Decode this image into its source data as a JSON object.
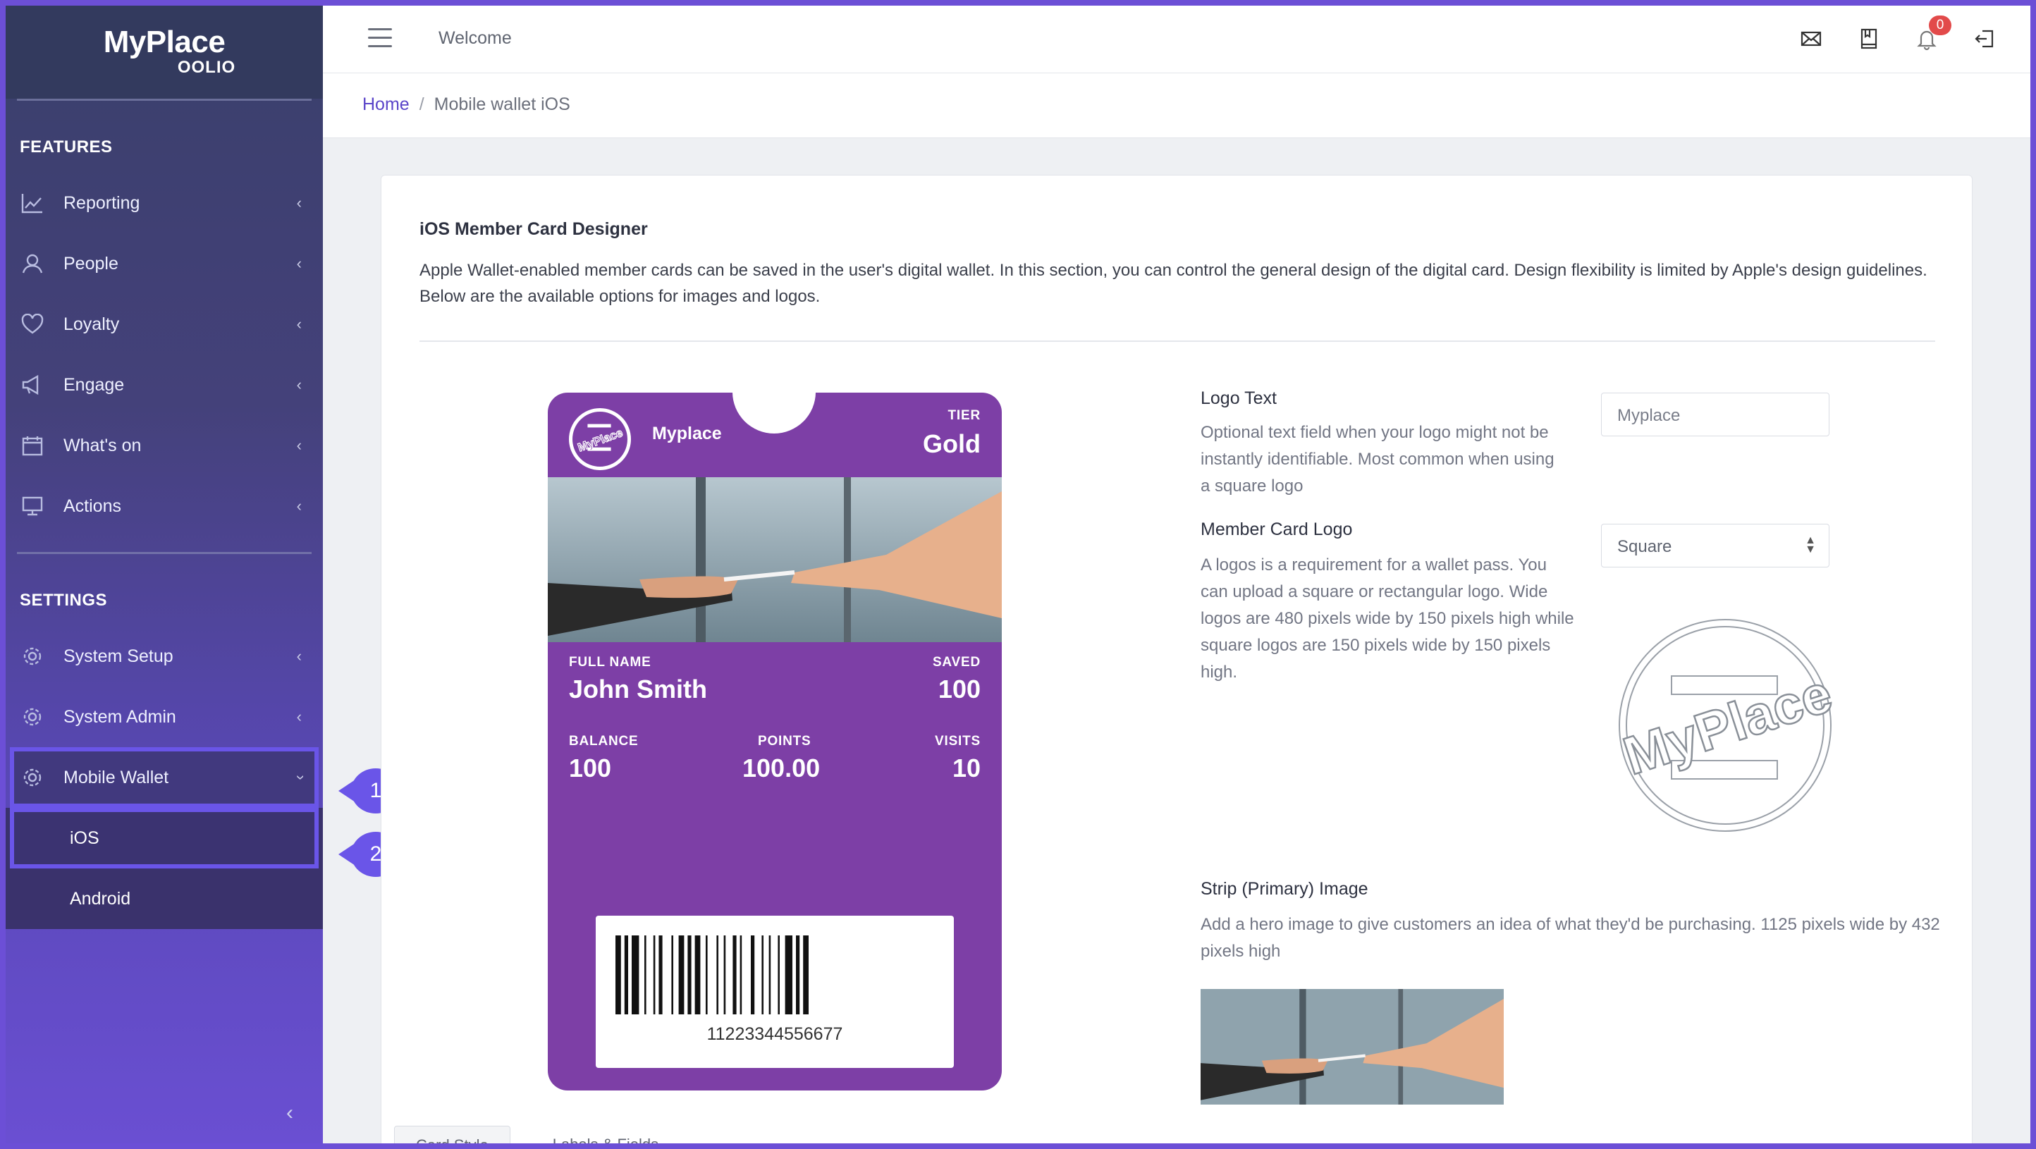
{
  "app": {
    "brand_name": "MyPlace",
    "brand_sub": "OOLIO"
  },
  "sidebar": {
    "features_title": "FEATURES",
    "features": [
      {
        "label": "Reporting",
        "icon": "chart-line-icon"
      },
      {
        "label": "People",
        "icon": "user-icon"
      },
      {
        "label": "Loyalty",
        "icon": "heart-icon"
      },
      {
        "label": "Engage",
        "icon": "megaphone-icon"
      },
      {
        "label": "What's on",
        "icon": "calendar-icon"
      },
      {
        "label": "Actions",
        "icon": "monitor-icon"
      }
    ],
    "settings_title": "SETTINGS",
    "settings": [
      {
        "label": "System Setup",
        "icon": "gear-icon"
      },
      {
        "label": "System Admin",
        "icon": "gear-icon"
      },
      {
        "label": "Mobile Wallet",
        "icon": "gear-icon"
      }
    ],
    "mobile_wallet_sub": [
      "iOS",
      "Android"
    ],
    "annotations": [
      "1",
      "2"
    ]
  },
  "topbar": {
    "welcome": "Welcome",
    "notification_count": "0"
  },
  "breadcrumb": {
    "home": "Home",
    "separator": "/",
    "current": "Mobile wallet iOS"
  },
  "designer": {
    "title": "iOS Member Card Designer",
    "description": "Apple Wallet-enabled member cards can be saved in the user's digital wallet. In this section, you can control the general design of the digital card. Design flexibility is limited by Apple's design guidelines. Below are the available options for images and logos."
  },
  "pass": {
    "brand_text": "Myplace",
    "tier_label": "TIER",
    "tier_value": "Gold",
    "full_name_label": "FULL NAME",
    "full_name_value": "John Smith",
    "saved_label": "SAVED",
    "saved_value": "100",
    "balance_label": "BALANCE",
    "balance_value": "100",
    "points_label": "POINTS",
    "points_value": "100.00",
    "visits_label": "VISITS",
    "visits_value": "10",
    "barcode_number": "11223344556677",
    "color": "#7d3fa6"
  },
  "form": {
    "logo_text_label": "Logo Text",
    "logo_text_help": "Optional text field when your logo might not be instantly identifiable. Most common when using a square logo",
    "logo_text_placeholder": "Myplace",
    "member_logo_label": "Member Card Logo",
    "member_logo_help": "A logos is a requirement for a wallet pass. You can upload a square or rectangular logo. Wide logos are 480 pixels wide by 150 pixels high while square logos are 150 pixels wide by 150 pixels high.",
    "member_logo_value": "Square",
    "logo_preview_text": "MyPlace",
    "strip_label": "Strip (Primary) Image",
    "strip_help": "Add a hero image to give customers an idea of what they'd be purchasing. 1125 pixels wide by 432 pixels high"
  },
  "tabs": [
    "Card Style",
    "Labels & Fields"
  ]
}
